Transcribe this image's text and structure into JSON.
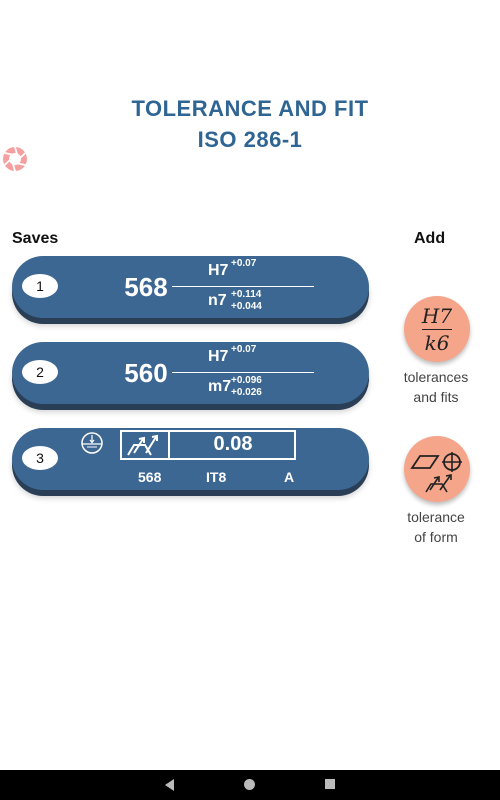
{
  "header": {
    "title_line1": "TOLERANCE AND FIT",
    "title_line2": "ISO 286-1"
  },
  "icons": {
    "shutter": "camera-shutter-icon",
    "flatness": "flatness-symbol-icon",
    "runout": "total-runout-icon",
    "form": "geometric-tolerance-icon"
  },
  "colors": {
    "title": "#2f6592",
    "card": "#3d6793",
    "add_button": "#f5a58a",
    "shutter": "#f5a0a0"
  },
  "saves": {
    "label": "Saves",
    "items": [
      {
        "index": "1",
        "size": "568",
        "hole": "H7",
        "hole_upper": "+0.07",
        "shaft": "n7",
        "shaft_upper": "+0.114",
        "shaft_lower": "+0.044"
      },
      {
        "index": "2",
        "size": "560",
        "hole": "H7",
        "hole_upper": "+0.07",
        "shaft": "m7",
        "shaft_upper": "+0.096",
        "shaft_lower": "+0.026"
      }
    ],
    "form_item": {
      "index": "3",
      "value": "0.08",
      "size": "568",
      "grade": "IT8",
      "datum": "A"
    }
  },
  "add": {
    "label": "Add",
    "fits_top": "H7",
    "fits_bottom": "k6",
    "fits_label_line1": "tolerances",
    "fits_label_line2": "and fits",
    "form_label_line1": "tolerance",
    "form_label_line2": "of form"
  }
}
